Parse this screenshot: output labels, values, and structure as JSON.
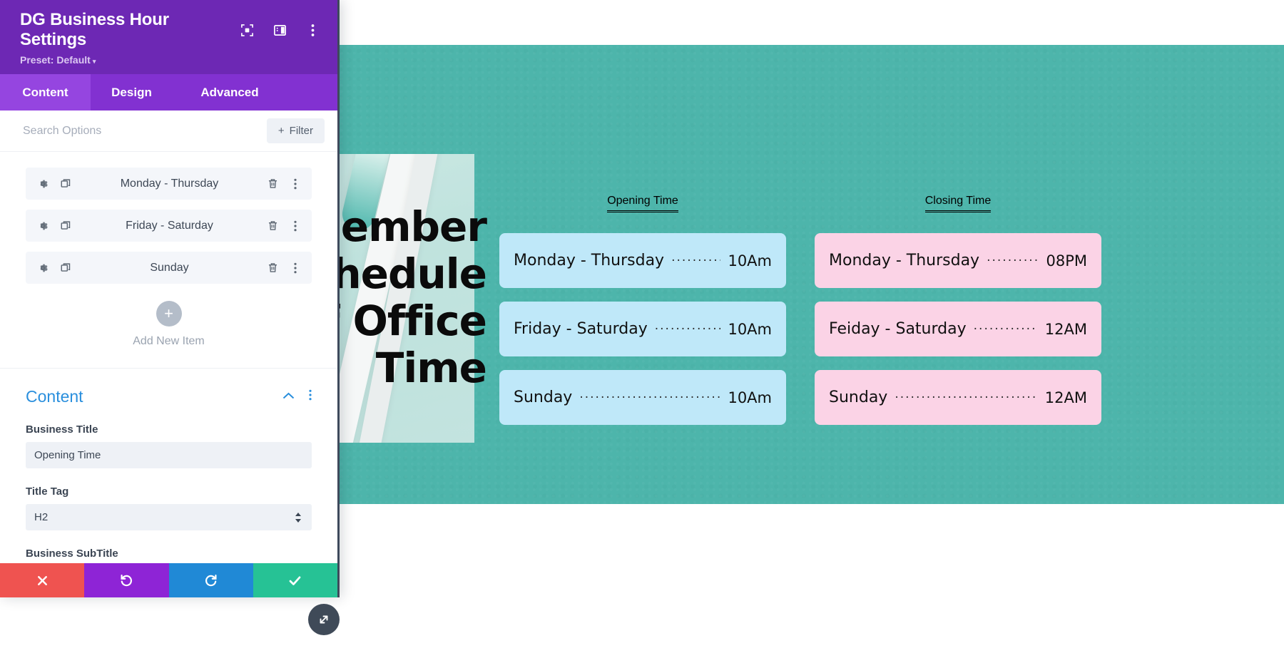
{
  "panel": {
    "title": "DG Business Hour Settings",
    "preset_label": "Preset: Default",
    "preset_caret": "▾",
    "header_icons": [
      "focus-frame-icon",
      "layout-panel-icon",
      "kebab-menu-icon"
    ],
    "tabs": [
      {
        "label": "Content",
        "active": true
      },
      {
        "label": "Design",
        "active": false
      },
      {
        "label": "Advanced",
        "active": false
      }
    ],
    "search": {
      "value": "",
      "placeholder": "Search Options"
    },
    "filter_button": {
      "label": "Filter",
      "icon": "plus-icon"
    },
    "items": [
      {
        "label": "Monday - Thursday"
      },
      {
        "label": "Friday - Saturday"
      },
      {
        "label": "Sunday"
      }
    ],
    "add_new": {
      "label": "Add New Item",
      "icon": "plus-icon"
    },
    "content_section": {
      "title": "Content",
      "collapse_icon": "chevron-up-icon",
      "menu_icon": "kebab-menu-icon",
      "fields": [
        {
          "label": "Business Title",
          "value": "Opening Time",
          "placeholder": "",
          "type": "text"
        },
        {
          "label": "Title Tag",
          "value": "H2",
          "placeholder": "",
          "type": "select"
        },
        {
          "label": "Business SubTitle",
          "value": "",
          "placeholder": "",
          "type": "text"
        }
      ]
    },
    "footer_buttons": [
      {
        "name": "cancel",
        "icon": "close-x-icon"
      },
      {
        "name": "undo",
        "icon": "undo-arrow-icon"
      },
      {
        "name": "redo",
        "icon": "redo-arrow-icon"
      },
      {
        "name": "save",
        "icon": "checkmark-icon"
      }
    ],
    "resize_handle_icon": "resize-diagonal-icon"
  },
  "page": {
    "hero_background": "#4db5ab",
    "headline": "Remember\nSchedule\nOf Office\nTime",
    "columns": [
      {
        "title": "Opening Time",
        "accent": "#bfe8f9",
        "rows": [
          {
            "day": "Monday - Thursday",
            "time": "10Am"
          },
          {
            "day": "Friday - Saturday",
            "time": "10Am"
          },
          {
            "day": "Sunday",
            "time": "10Am"
          }
        ]
      },
      {
        "title": "Closing Time",
        "accent": "#fbd3e6",
        "rows": [
          {
            "day": "Monday - Thursday",
            "time": "08PM"
          },
          {
            "day": "Feiday - Saturday",
            "time": "12AM"
          },
          {
            "day": "Sunday",
            "time": "12AM"
          }
        ]
      }
    ]
  }
}
